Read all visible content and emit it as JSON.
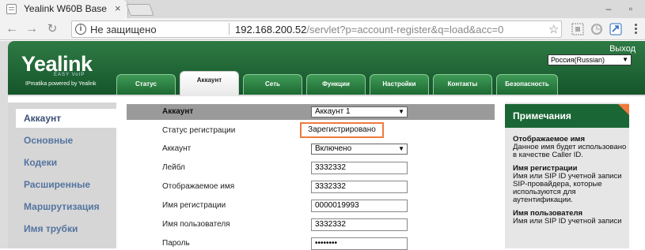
{
  "browser": {
    "tab_title": "Yealink W60B Base",
    "tab_close": "×",
    "security_label": "Не защищено",
    "url_host": "192.168.200.52",
    "url_path": "/servlet?p=account-register&q=load&acc=0"
  },
  "header": {
    "logo": "Yealink",
    "logo_sub": "EASY VoIP",
    "powered_by": "IPmatika powered by Yealink",
    "logout": "Выход",
    "language": "Россия(Russian)"
  },
  "nav_tabs": [
    "Статус",
    "Аккаунт",
    "Сеть",
    "Функции",
    "Настройки",
    "Контакты",
    "Безопасность"
  ],
  "active_tab": "Аккаунт",
  "sidebar": {
    "items": [
      "Аккаунт",
      "Основные",
      "Кодеки",
      "Расширенные",
      "Маршрутизация",
      "Имя трубки"
    ]
  },
  "form": {
    "header_label": "Аккаунт",
    "header_value": "Аккаунт 1",
    "rows": [
      {
        "label": "Статус регистрации",
        "value": "Зарегистрировано"
      },
      {
        "label": "Аккаунт",
        "value": "Включено"
      },
      {
        "label": "Лейбл",
        "value": "3332332"
      },
      {
        "label": "Отображаемое имя",
        "value": "3332332"
      },
      {
        "label": "Имя регистрации",
        "value": "0000019993"
      },
      {
        "label": "Имя пользователя",
        "value": "3332332"
      },
      {
        "label": "Пароль",
        "value": "••••••••"
      }
    ]
  },
  "notes": {
    "title": "Примечания",
    "items": [
      {
        "heading": "Отображаемое имя",
        "text": "Данное имя будет использовано в качестве Caller ID."
      },
      {
        "heading": "Имя регистрации",
        "text": "Имя или SIP ID учетной записи SIP-провайдера, которые используются для аутентификации."
      },
      {
        "heading": "Имя пользователя",
        "text": "Имя или SIP ID учетной записи"
      }
    ]
  },
  "colors": {
    "header_green": "#15552a",
    "notes_green": "#1a6634",
    "highlight_orange": "#f07a3c",
    "sidebar_link": "#5474a0"
  }
}
